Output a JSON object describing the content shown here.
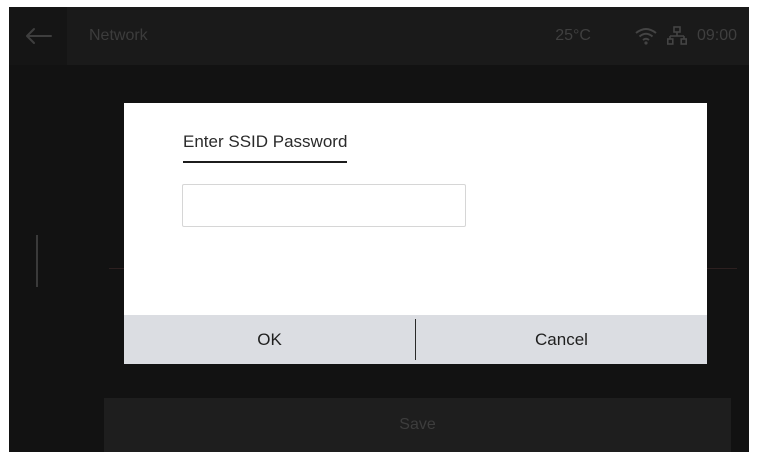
{
  "header": {
    "title": "Network",
    "temperature": "25°C",
    "time": "09:00",
    "back_icon": "arrow-left-icon",
    "wifi_icon": "wifi-icon",
    "ethernet_icon": "ethernet-icon"
  },
  "background_screen": {
    "save_label": "Save"
  },
  "dialog": {
    "title": "Enter SSID Password",
    "password_value": "",
    "ok_label": "OK",
    "cancel_label": "Cancel"
  }
}
